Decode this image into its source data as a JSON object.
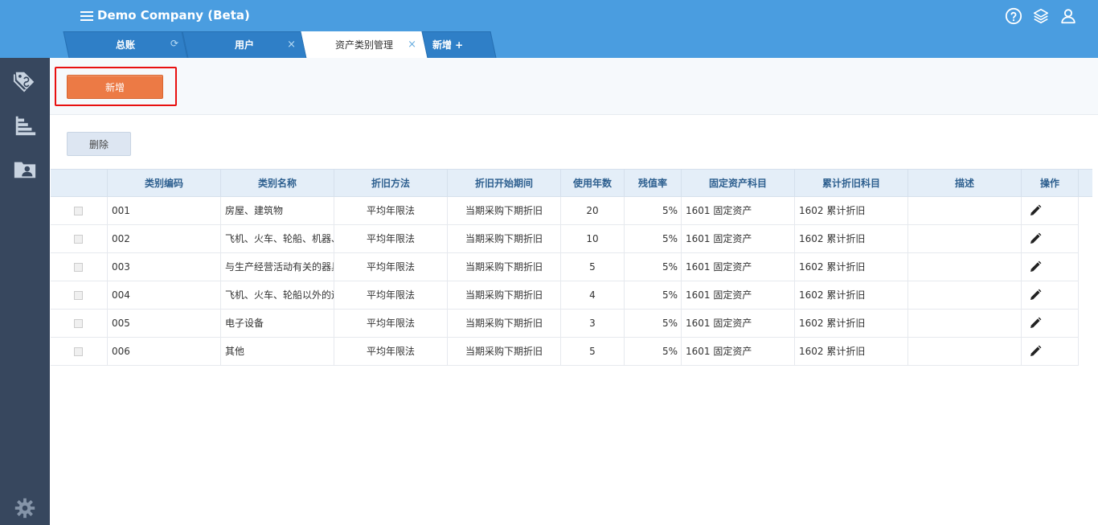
{
  "header": {
    "company": "Demo Company (Beta)",
    "icons": [
      "help-icon",
      "layers-icon",
      "user-icon"
    ]
  },
  "tabs": [
    {
      "label": "总账",
      "refresh": "⟳"
    },
    {
      "label": "用户",
      "close": "×"
    },
    {
      "label": "资产类别管理",
      "close": "×",
      "active": true
    },
    {
      "label": "新增 +"
    }
  ],
  "sidebar": {
    "icons": [
      "tag-icon",
      "bar-chart-icon",
      "contacts-folder-icon",
      "settings-gear-icon"
    ]
  },
  "toolbar": {
    "add_label": "新增",
    "delete_label": "删除"
  },
  "table": {
    "columns": [
      "",
      "类别编码",
      "类别名称",
      "折旧方法",
      "折旧开始期间",
      "使用年数",
      "残值率",
      "固定资产科目",
      "累计折旧科目",
      "描述",
      "操作"
    ],
    "rows": [
      {
        "code": "001",
        "name": "房屋、建筑物",
        "method": "平均年限法",
        "start": "当期采购下期折旧",
        "years": "20",
        "rate": "5%",
        "asset_acct": "1601 固定资产",
        "dep_acct": "1602 累计折旧",
        "desc": ""
      },
      {
        "code": "002",
        "name": "飞机、火车、轮船、机器、机械和其他生产设备",
        "method": "平均年限法",
        "start": "当期采购下期折旧",
        "years": "10",
        "rate": "5%",
        "asset_acct": "1601 固定资产",
        "dep_acct": "1602 累计折旧",
        "desc": ""
      },
      {
        "code": "003",
        "name": "与生产经营活动有关的器具、工具、家具等",
        "method": "平均年限法",
        "start": "当期采购下期折旧",
        "years": "5",
        "rate": "5%",
        "asset_acct": "1601 固定资产",
        "dep_acct": "1602 累计折旧",
        "desc": ""
      },
      {
        "code": "004",
        "name": "飞机、火车、轮船以外的运输工具",
        "method": "平均年限法",
        "start": "当期采购下期折旧",
        "years": "4",
        "rate": "5%",
        "asset_acct": "1601 固定资产",
        "dep_acct": "1602 累计折旧",
        "desc": ""
      },
      {
        "code": "005",
        "name": "电子设备",
        "method": "平均年限法",
        "start": "当期采购下期折旧",
        "years": "3",
        "rate": "5%",
        "asset_acct": "1601 固定资产",
        "dep_acct": "1602 累计折旧",
        "desc": ""
      },
      {
        "code": "006",
        "name": "其他",
        "method": "平均年限法",
        "start": "当期采购下期折旧",
        "years": "5",
        "rate": "5%",
        "asset_acct": "1601 固定资产",
        "dep_acct": "1602 累计折旧",
        "desc": ""
      }
    ]
  },
  "colors": {
    "header_bg": "#4a9de0",
    "sidebar_bg": "#37475e",
    "add_button": "#ec7a45",
    "highlight": "#e81010"
  }
}
